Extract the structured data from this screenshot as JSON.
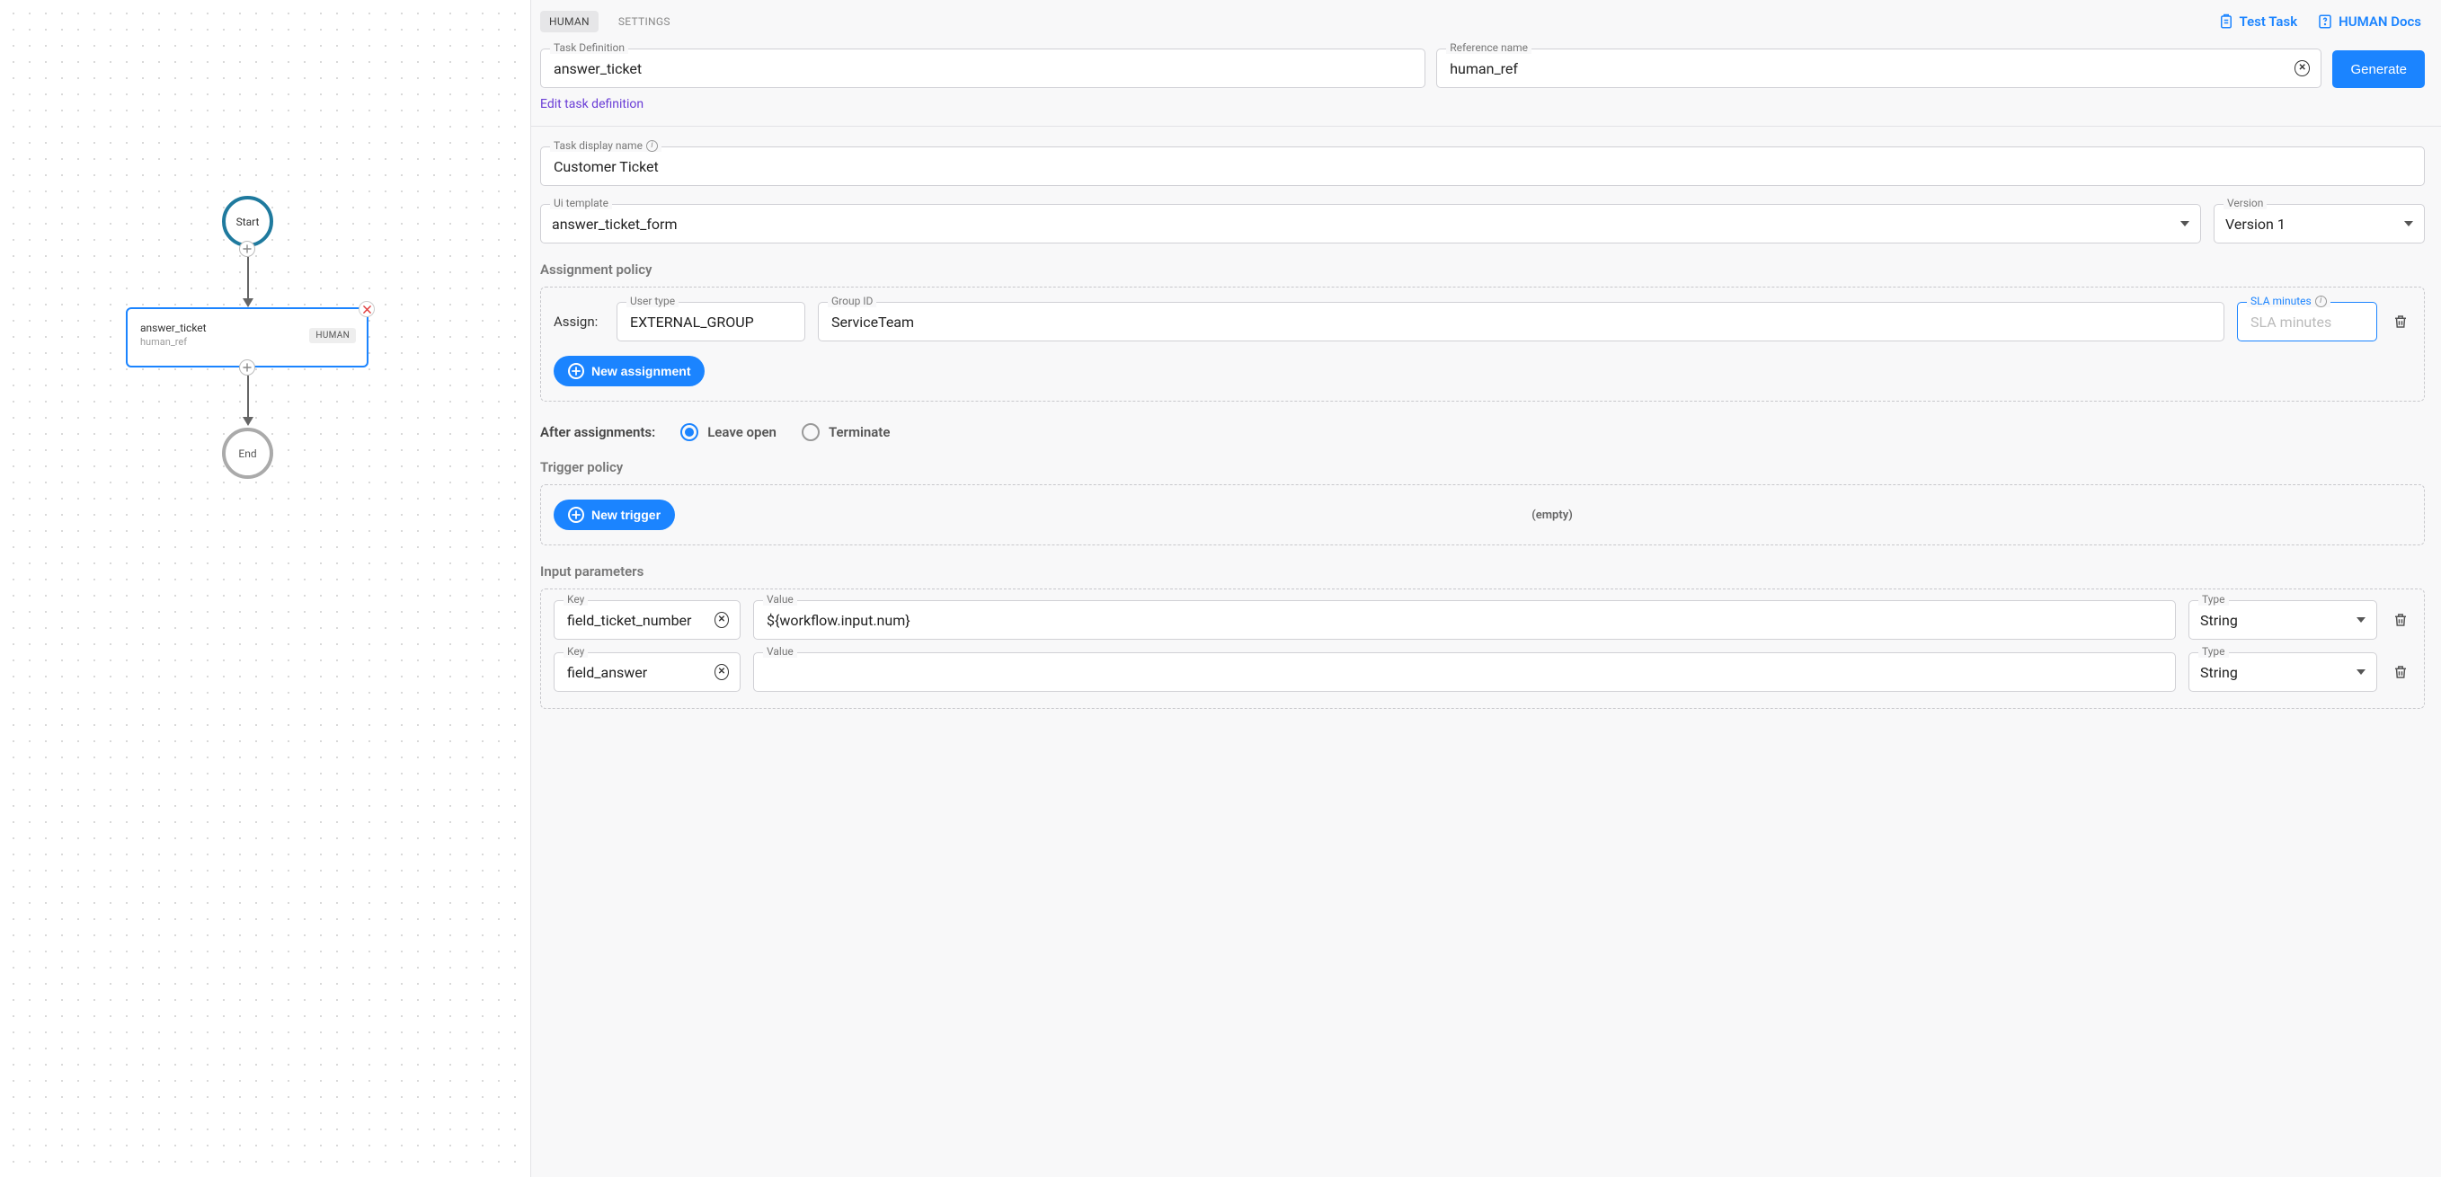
{
  "canvas": {
    "start_label": "Start",
    "end_label": "End",
    "task": {
      "title": "answer_ticket",
      "ref": "human_ref",
      "badge": "HUMAN"
    }
  },
  "tabs": {
    "human": "HUMAN",
    "settings": "SETTINGS"
  },
  "top_links": {
    "test_task": "Test Task",
    "docs": "HUMAN Docs"
  },
  "task_def": {
    "label": "Task Definition",
    "value": "answer_ticket",
    "ref_label": "Reference name",
    "ref_value": "human_ref",
    "generate": "Generate",
    "edit_link": "Edit task definition"
  },
  "display_name": {
    "label": "Task display name",
    "value": "Customer Ticket"
  },
  "ui_template": {
    "label": "Ui template",
    "value": "answer_ticket_form"
  },
  "version": {
    "label": "Version",
    "value": "Version 1"
  },
  "assignment": {
    "title": "Assignment policy",
    "assign_label": "Assign:",
    "user_type_label": "User type",
    "user_type_value": "EXTERNAL_GROUP",
    "group_label": "Group ID",
    "group_value": "ServiceTeam",
    "sla_label": "SLA minutes",
    "sla_placeholder": "SLA minutes",
    "new_btn": "New assignment"
  },
  "after_assign": {
    "label": "After assignments:",
    "leave": "Leave open",
    "terminate": "Terminate"
  },
  "trigger": {
    "title": "Trigger policy",
    "new_btn": "New trigger",
    "empty": "(empty)"
  },
  "inputs": {
    "title": "Input parameters",
    "key_label": "Key",
    "value_label": "Value",
    "type_label": "Type",
    "rows": [
      {
        "key": "field_ticket_number",
        "value": "${workflow.input.num}",
        "type": "String"
      },
      {
        "key": "field_answer",
        "value": "",
        "type": "String"
      }
    ]
  }
}
